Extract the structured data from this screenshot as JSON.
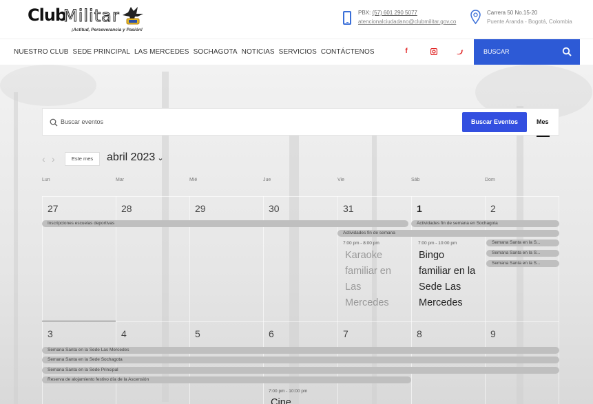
{
  "header": {
    "logo": {
      "club": "Club",
      "militar": "Militar",
      "tagline": "¡Actitud, Perseverancia y Pasión!"
    },
    "phone": {
      "label": "PBX:",
      "number": "(57) 601 290 5077",
      "email": "atencionalciudadano@clubmilitar.gov.co"
    },
    "address": {
      "line1": "Carrera 50 No.15-20",
      "line2": "Puente Aranda - Bogotá, Colombia"
    }
  },
  "nav": {
    "items": [
      "NUESTRO CLUB",
      "SEDE PRINCIPAL",
      "LAS MERCEDES",
      "SOCHAGOTA",
      "NOTICIAS",
      "SERVICIOS",
      "CONTÁCTENOS"
    ],
    "social": [
      "facebook-icon",
      "instagram-icon",
      "twitter-icon"
    ],
    "search_label": "BUSCAR"
  },
  "events_bar": {
    "placeholder": "Buscar eventos",
    "button": "Buscar Eventos",
    "view": "Mes"
  },
  "month_nav": {
    "today": "Este mes",
    "title": "abril 2023"
  },
  "calendar": {
    "weekdays": [
      "Lun",
      "Mar",
      "Mié",
      "Jue",
      "Vie",
      "Sáb",
      "Dom"
    ],
    "week1": {
      "days": [
        "27",
        "28",
        "29",
        "30",
        "31",
        "1",
        "2"
      ],
      "multi_events": [
        "Inscripciones escuelas deportivas",
        "Actividades fin de semana en Sochagota",
        "Actividades fin de semana",
        "Semana Santa en la S...",
        "Semana Santa en la S...",
        "Semana Santa en la S..."
      ],
      "events": [
        {
          "time": "7:00 pm - 8:00 pm",
          "title_lines": [
            "Karaoke",
            "familiar en",
            "Las",
            "Mercedes"
          ]
        },
        {
          "time": "7:00 pm - 10:00 pm",
          "title_lines": [
            "Bingo",
            "familiar en la",
            "Sede Las",
            "Mercedes"
          ]
        }
      ]
    },
    "week2": {
      "days": [
        "3",
        "4",
        "5",
        "6",
        "7",
        "8",
        "9"
      ],
      "multi_events": [
        "Semana Santa en la Sede Las Mercedes",
        "Semana Santa en la Sede Sochagota",
        "Semana Santa en la Sede Principal",
        "Reserva de alojamiento festivo día de la Ascensión"
      ],
      "events": [
        {
          "time": "7:00 pm - 10:00 pm",
          "title_lines": [
            "Cine"
          ]
        }
      ]
    }
  },
  "colors": {
    "accent": "#334fe0",
    "nav_search": "#2d5ad6",
    "social": "#e02020",
    "event_bar": "#bfbfbf"
  }
}
